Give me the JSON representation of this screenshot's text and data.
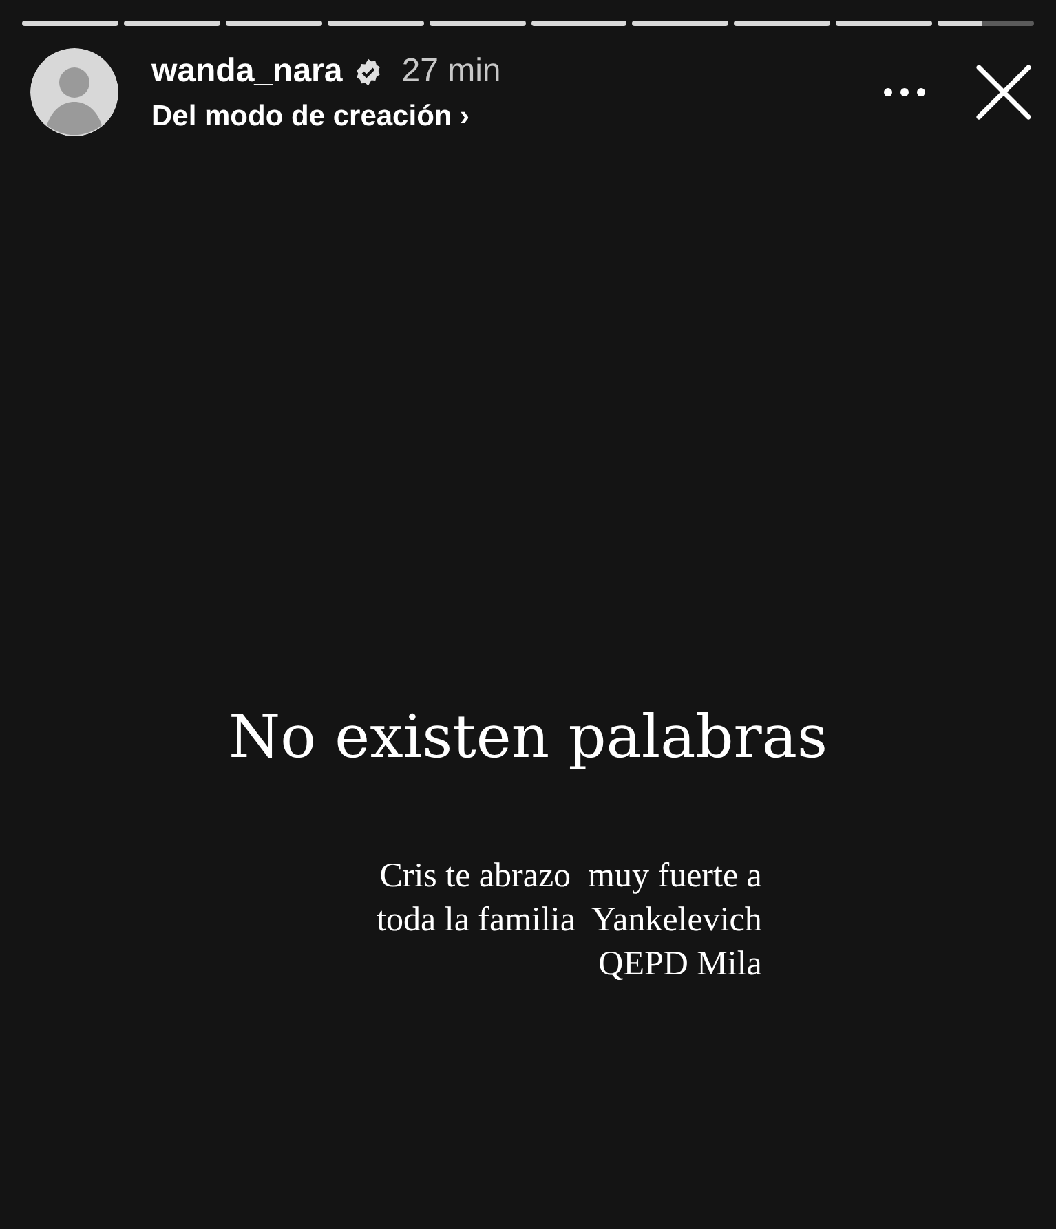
{
  "progress": [
    {
      "level": 1
    },
    {
      "level": 1
    },
    {
      "level": 1
    },
    {
      "level": 1
    },
    {
      "level": 1
    },
    {
      "level": 1
    },
    {
      "level": 1
    },
    {
      "level": 1
    },
    {
      "level": 1
    },
    {
      "level": 0.45
    }
  ],
  "header": {
    "username": "wanda_nara",
    "verified": true,
    "time": "27 min",
    "subtitle": "Del modo de creación",
    "chevron": "›"
  },
  "story": {
    "heading": "No existen palabras",
    "caption_lines": [
      "Cris te abrazo  muy fuerte a",
      "toda la familia  Yankelevich",
      "QEPD Mila"
    ]
  }
}
